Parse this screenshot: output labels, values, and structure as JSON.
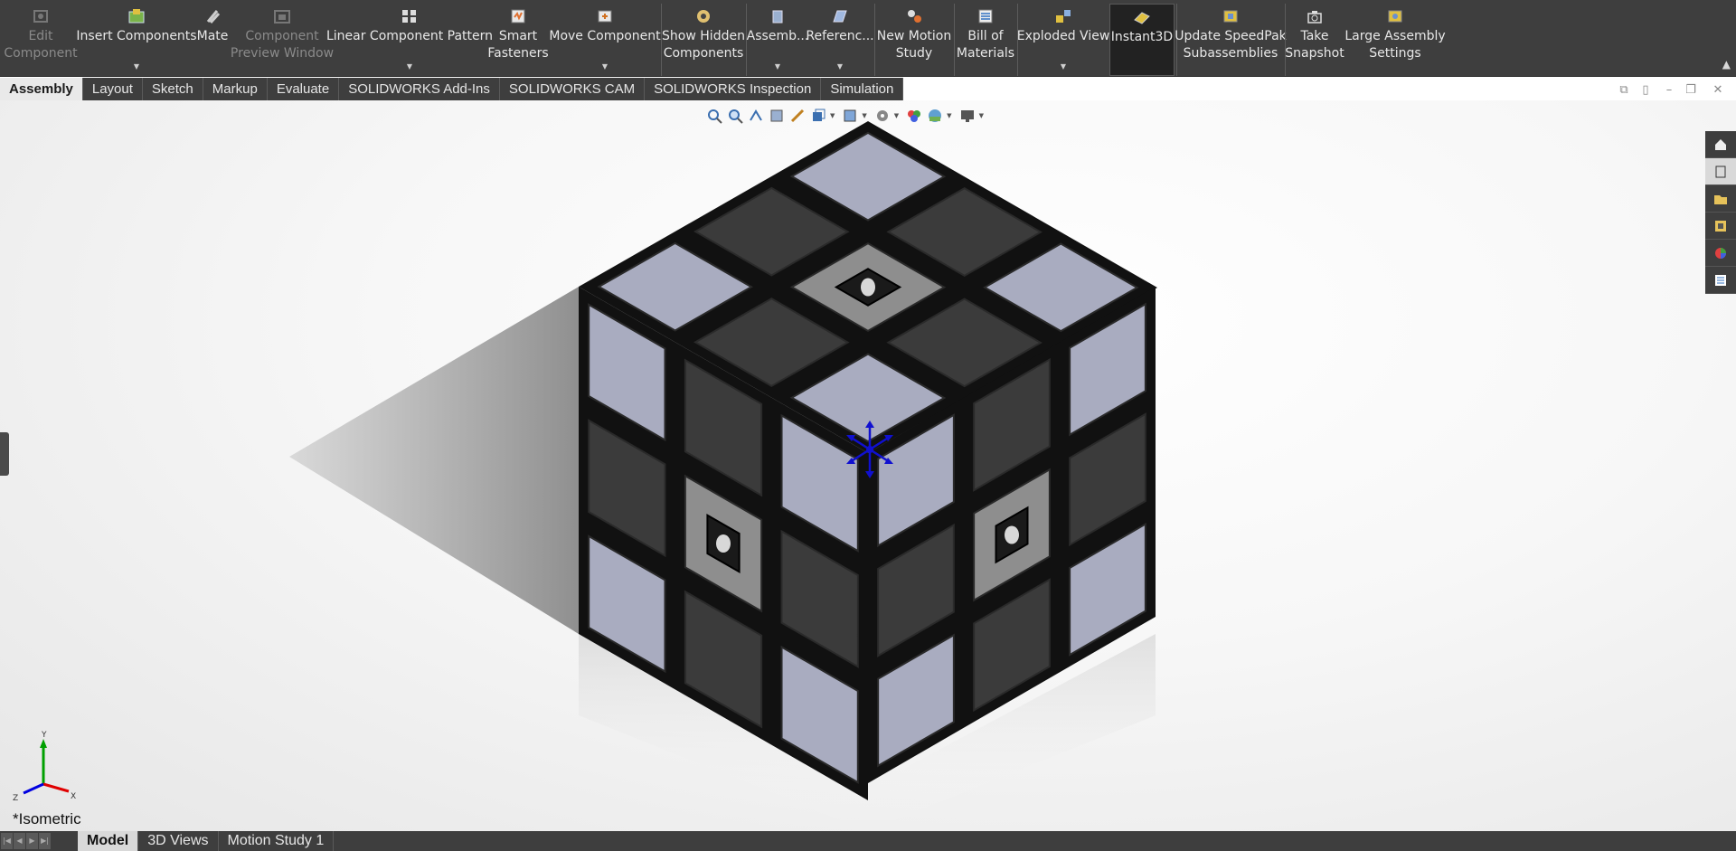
{
  "ribbon": {
    "buttons": [
      {
        "id": "edit-component",
        "label1": "Edit",
        "label2": "Component",
        "icon": "edit-component-icon",
        "disabled": true
      },
      {
        "id": "insert-components",
        "label1": "Insert Components",
        "label2": "",
        "icon": "insert-components-icon",
        "dropdown": true
      },
      {
        "id": "mate",
        "label1": "Mate",
        "label2": "",
        "icon": "mate-icon"
      },
      {
        "id": "component-preview-window",
        "label1": "Component",
        "label2": "Preview Window",
        "icon": "preview-window-icon",
        "disabled": true
      },
      {
        "id": "linear-component-pattern",
        "label1": "Linear Component Pattern",
        "label2": "",
        "icon": "linear-pattern-icon",
        "dropdown": true
      },
      {
        "id": "smart-fasteners",
        "label1": "Smart",
        "label2": "Fasteners",
        "icon": "smart-fasteners-icon"
      },
      {
        "id": "move-component",
        "label1": "Move Component",
        "label2": "",
        "icon": "move-component-icon",
        "dropdown": true
      },
      {
        "id": "show-hidden-components",
        "label1": "Show Hidden",
        "label2": "Components",
        "icon": "show-hidden-icon"
      },
      {
        "id": "assembly-features",
        "label1": "Assemb...",
        "label2": "",
        "icon": "assembly-features-icon",
        "dropdown": true
      },
      {
        "id": "reference-geometry",
        "label1": "Referenc...",
        "label2": "",
        "icon": "reference-geometry-icon",
        "dropdown": true
      },
      {
        "id": "new-motion-study",
        "label1": "New Motion",
        "label2": "Study",
        "icon": "motion-study-icon"
      },
      {
        "id": "bill-of-materials",
        "label1": "Bill of",
        "label2": "Materials",
        "icon": "bom-icon"
      },
      {
        "id": "exploded-view",
        "label1": "Exploded View",
        "label2": "",
        "icon": "exploded-view-icon",
        "dropdown": true
      },
      {
        "id": "instant3d",
        "label1": "Instant3D",
        "label2": "",
        "icon": "instant3d-icon",
        "active": true
      },
      {
        "id": "update-speedpak",
        "label1": "Update SpeedPak",
        "label2": "Subassemblies",
        "icon": "speedpak-icon"
      },
      {
        "id": "take-snapshot",
        "label1": "Take",
        "label2": "Snapshot",
        "icon": "camera-icon"
      },
      {
        "id": "large-assembly-settings",
        "label1": "Large Assembly",
        "label2": "Settings",
        "icon": "large-assembly-icon"
      }
    ]
  },
  "tabs": [
    "Assembly",
    "Layout",
    "Sketch",
    "Markup",
    "Evaluate",
    "SOLIDWORKS Add-Ins",
    "SOLIDWORKS CAM",
    "SOLIDWORKS Inspection",
    "Simulation"
  ],
  "active_tab": "Assembly",
  "bottom_tabs": [
    "Model",
    "3D Views",
    "Motion Study 1"
  ],
  "active_bottom_tab": "Model",
  "view_name": "*Isometric",
  "triad": {
    "x": "X",
    "y": "Y",
    "z": "Z"
  },
  "colors": {
    "ribbon_bg": "#3e3e3e",
    "tile_light": "#a9acc0",
    "tile_dark": "#3b3b3b",
    "center_tile": "#8e8e8e",
    "triad_x": "#e00000",
    "triad_y": "#00a000",
    "triad_z": "#0000e0"
  }
}
